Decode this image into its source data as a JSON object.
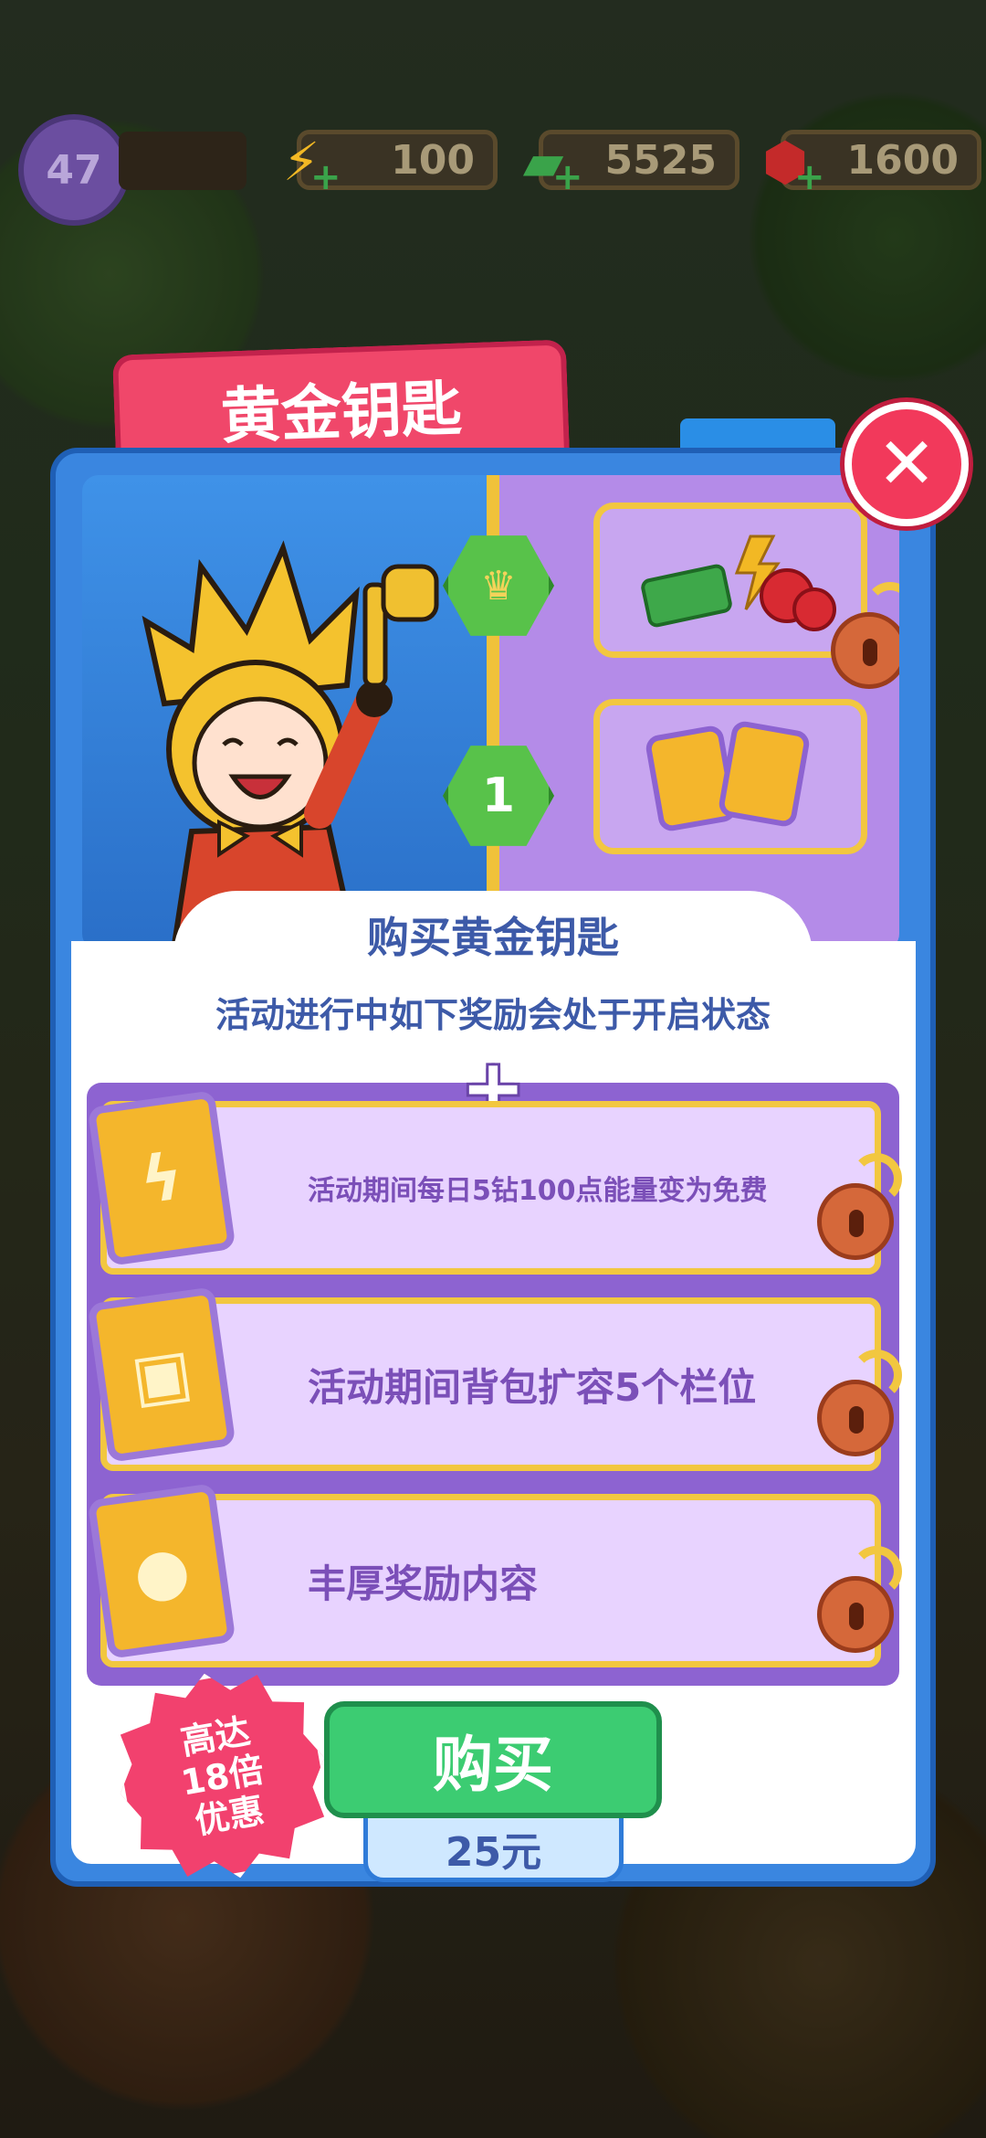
{
  "hud": {
    "level": "47",
    "energy": "100",
    "cash": "5525",
    "gems": "1600"
  },
  "dialog": {
    "title": "黄金钥匙",
    "close_icon": "close-icon",
    "reward_tiers": [
      {
        "tier_label": "",
        "tier_icon": "crown-icon"
      },
      {
        "tier_label": "1",
        "tier_icon": "hex-number-icon"
      }
    ],
    "subtitle": "购买黄金钥匙",
    "description": "活动进行中如下奖励会处于开启状态",
    "perks": [
      {
        "icon": "energy-card-icon",
        "text": "活动期间每日5钻100点能量变为免费"
      },
      {
        "icon": "backpack-card-icon",
        "text": "活动期间背包扩容5个栏位"
      },
      {
        "icon": "balloon-card-icon",
        "text": "丰厚奖励内容"
      }
    ],
    "badge_lines": [
      "高达",
      "18倍",
      "优惠"
    ],
    "buy_label": "购买",
    "price": "25元"
  },
  "colors": {
    "title_bg": "#f0476a",
    "panel_blue": "#3a86e0",
    "perk_purple": "#8d63d1",
    "buy_green": "#3ccc72",
    "gold": "#f2c740"
  }
}
